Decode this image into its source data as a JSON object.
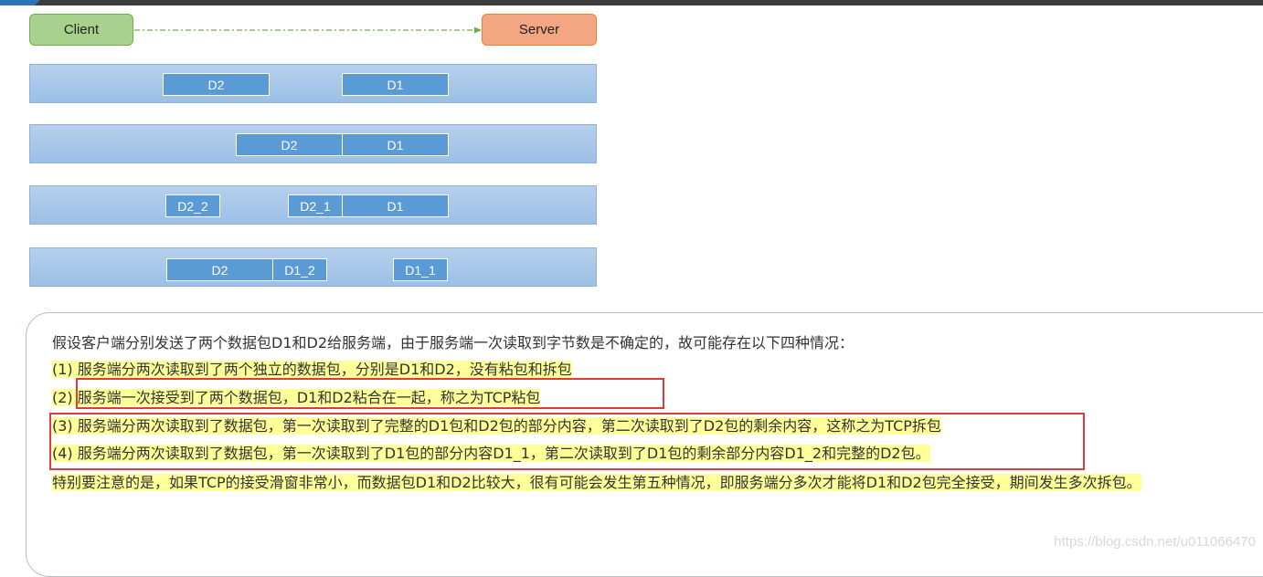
{
  "nodes": {
    "client": "Client",
    "server": "Server"
  },
  "colors": {
    "client_fill": "#a9d18e",
    "server_fill": "#f4a582",
    "lane_fill": "#9bbfe6",
    "packet_fill": "#5b9bd5",
    "highlight": "#ffff99",
    "red_box": "#e03b3b"
  },
  "lanes": [
    {
      "packets": [
        "D2",
        "D1"
      ]
    },
    {
      "packets": [
        "D2",
        "D1"
      ]
    },
    {
      "packets": [
        "D2_2",
        "D2_1",
        "D1"
      ]
    },
    {
      "packets": [
        "D2",
        "D1_2",
        "D1_1"
      ]
    }
  ],
  "text": {
    "intro": "假设客户端分别发送了两个数据包D1和D2给服务端，由于服务端一次读取到字节数是不确定的，故可能存在以下四种情况：",
    "case1": "(1) 服务端分两次读取到了两个独立的数据包，分别是D1和D2，没有粘包和拆包",
    "case2": "(2) 服务端一次接受到了两个数据包，D1和D2粘合在一起，称之为TCP粘包",
    "case3": "(3) 服务端分两次读取到了数据包，第一次读取到了完整的D1包和D2包的部分内容，第二次读取到了D2包的剩余内容，这称之为TCP拆包",
    "case4": "(4) 服务端分两次读取到了数据包，第一次读取到了D1包的部分内容D1_1，第二次读取到了D1包的剩余部分内容D1_2和完整的D2包。",
    "note": "特别要注意的是，如果TCP的接受滑窗非常小，而数据包D1和D2比较大，很有可能会发生第五种情况，即服务端分多次才能将D1和D2包完全接受，期间发生多次拆包。"
  },
  "watermark": "https://blog.csdn.net/u011066470"
}
